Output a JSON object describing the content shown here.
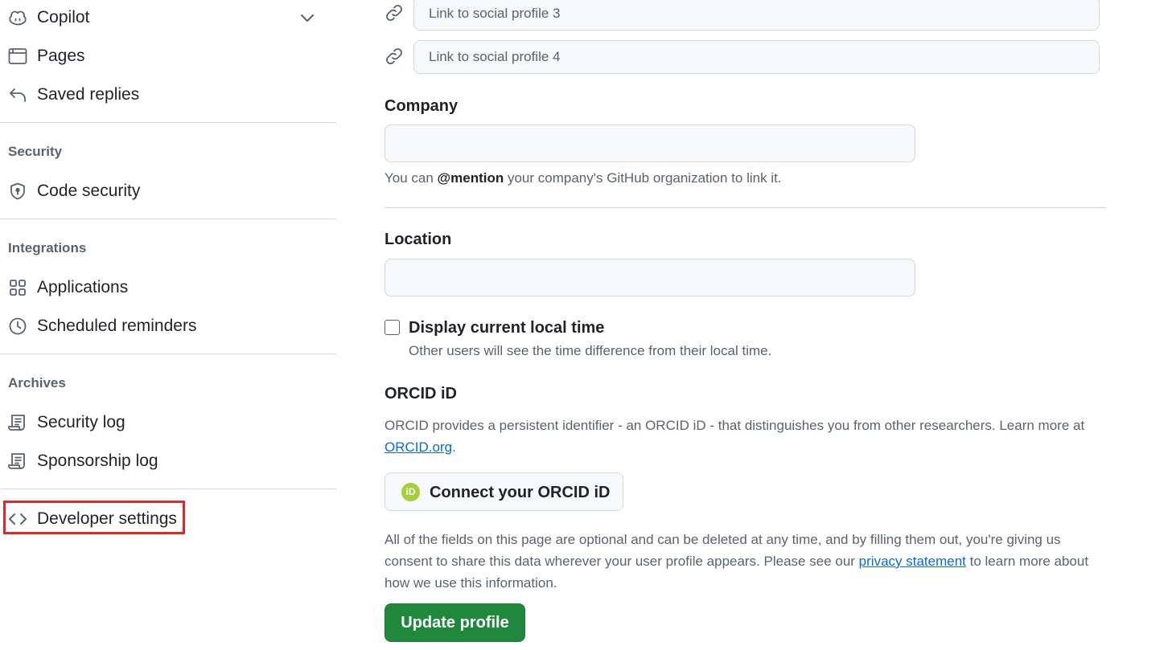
{
  "sidebar": {
    "top_items": [
      {
        "label": "Copilot",
        "icon": "copilot-icon"
      },
      {
        "label": "Pages",
        "icon": "browser-icon"
      },
      {
        "label": "Saved replies",
        "icon": "reply-icon"
      }
    ],
    "sections": [
      {
        "heading": "Security",
        "items": [
          {
            "label": "Code security",
            "icon": "shield-lock-icon"
          }
        ]
      },
      {
        "heading": "Integrations",
        "items": [
          {
            "label": "Applications",
            "icon": "apps-icon"
          },
          {
            "label": "Scheduled reminders",
            "icon": "clock-icon"
          }
        ]
      },
      {
        "heading": "Archives",
        "items": [
          {
            "label": "Security log",
            "icon": "log-icon"
          },
          {
            "label": "Sponsorship log",
            "icon": "log-icon"
          }
        ]
      }
    ],
    "developer_settings": {
      "label": "Developer settings",
      "icon": "code-icon"
    },
    "highlight_color": "#e1262a"
  },
  "social": {
    "profile3_placeholder": "Link to social profile 3",
    "profile4_placeholder": "Link to social profile 4"
  },
  "company": {
    "label": "Company",
    "value": "",
    "note_prefix": "You can ",
    "note_mention": "@mention",
    "note_suffix": " your company's GitHub organization to link it."
  },
  "location": {
    "label": "Location",
    "value": ""
  },
  "local_time": {
    "checked": false,
    "label": "Display current local time",
    "note": "Other users will see the time difference from their local time."
  },
  "orcid": {
    "title": "ORCID iD",
    "desc_prefix": "ORCID provides a persistent identifier - an ORCID iD - that distinguishes you from other researchers. Learn more at ",
    "link_text": "ORCID.org",
    "desc_suffix": ".",
    "badge_text": "iD",
    "button_label": "Connect your ORCID iD",
    "badge_color": "#a6ce39"
  },
  "disclaimer": {
    "prefix": "All of the fields on this page are optional and can be deleted at any time, and by filling them out, you're giving us consent to share this data wherever your user profile appears. Please see our ",
    "link_text": "privacy statement",
    "suffix": " to learn more about how we use this information."
  },
  "update_button": {
    "label": "Update profile",
    "color": "#1f883d"
  }
}
